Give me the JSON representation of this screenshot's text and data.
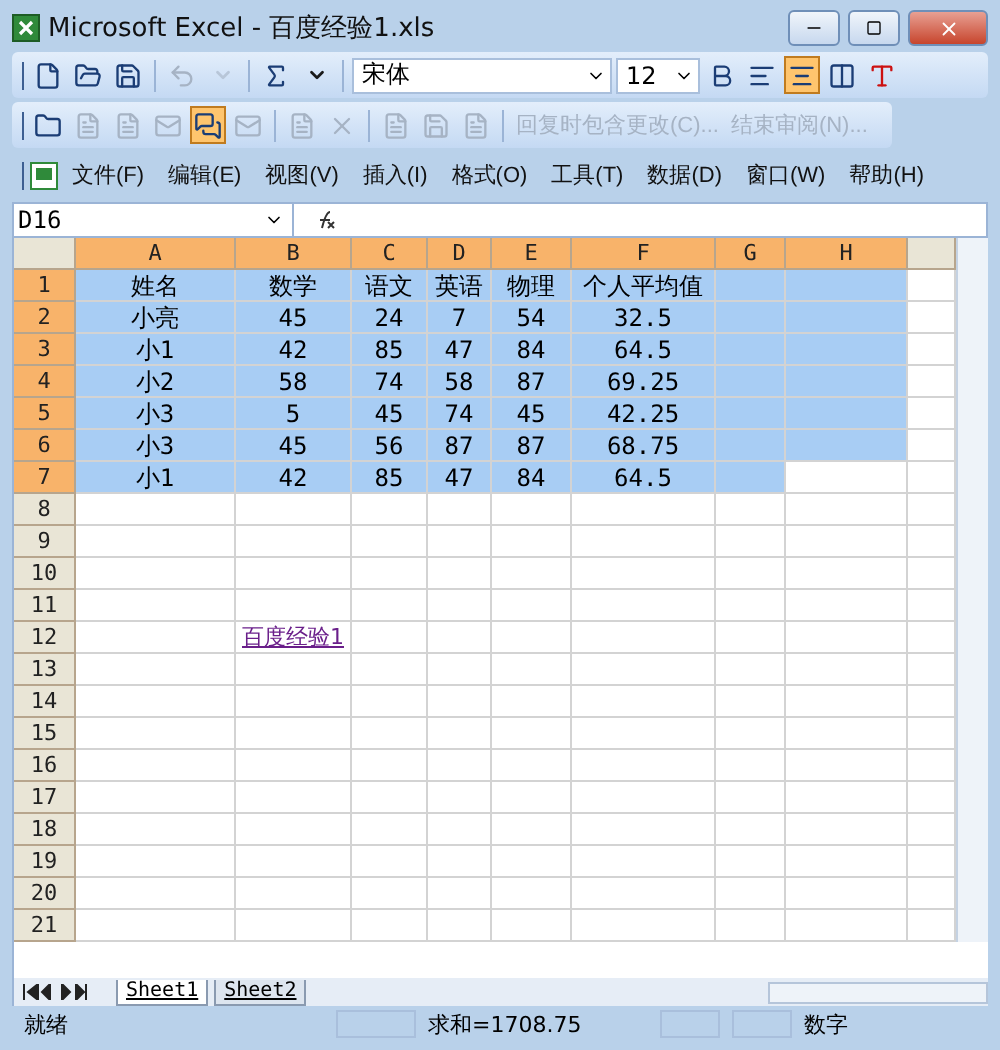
{
  "window": {
    "title": "Microsoft Excel - 百度经验1.xls"
  },
  "toolbar": {
    "items": [
      {
        "kind": "button",
        "disabled": false
      },
      {
        "kind": "button",
        "disabled": false
      },
      {
        "kind": "button",
        "disabled": false
      },
      {
        "kind": "sep"
      },
      {
        "kind": "button",
        "disabled": true
      },
      {
        "kind": "caret",
        "disabled": true
      },
      {
        "kind": "sep"
      },
      {
        "kind": "button",
        "disabled": false
      },
      {
        "kind": "caret",
        "disabled": false
      }
    ],
    "font": "宋体",
    "size": "12",
    "format": [
      {
        "selected": false
      },
      {
        "selected": false
      },
      {
        "selected": true
      },
      {
        "selected": false
      },
      {
        "selected": false
      }
    ]
  },
  "review_toolbar": {
    "items": [
      {
        "kind": "button",
        "disabled": false,
        "selected": false
      },
      {
        "kind": "button",
        "disabled": true,
        "selected": false
      },
      {
        "kind": "button",
        "disabled": true,
        "selected": false
      },
      {
        "kind": "button",
        "disabled": true,
        "selected": false
      },
      {
        "kind": "button",
        "disabled": false,
        "selected": true
      },
      {
        "kind": "button",
        "disabled": true,
        "selected": false
      },
      {
        "kind": "sep"
      },
      {
        "kind": "button",
        "disabled": true,
        "selected": false
      },
      {
        "kind": "button",
        "disabled": true,
        "selected": false
      },
      {
        "kind": "sep"
      },
      {
        "kind": "button",
        "disabled": true,
        "selected": false
      },
      {
        "kind": "button",
        "disabled": true,
        "selected": false
      },
      {
        "kind": "button",
        "disabled": true,
        "selected": false
      },
      {
        "kind": "sep"
      },
      {
        "kind": "text",
        "label": "回复时包含更改(C)...",
        "disabled": true
      },
      {
        "kind": "text",
        "label": "结束审阅(N)...",
        "disabled": true
      }
    ]
  },
  "menu": [
    "文件(F)",
    "编辑(E)",
    "视图(V)",
    "插入(I)",
    "格式(O)",
    "工具(T)",
    "数据(D)",
    "窗口(W)",
    "帮助(H)"
  ],
  "name_box": "D16",
  "columns": [
    {
      "label": "A",
      "selected": true
    },
    {
      "label": "B",
      "selected": true
    },
    {
      "label": "C",
      "selected": true
    },
    {
      "label": "D",
      "selected": true
    },
    {
      "label": "E",
      "selected": true
    },
    {
      "label": "F",
      "selected": true
    },
    {
      "label": "G",
      "selected": true
    },
    {
      "label": "H",
      "selected": true
    }
  ],
  "rows": [
    {
      "label": "1",
      "selected": true,
      "cells": [
        {
          "text": "姓名",
          "selected": true
        },
        {
          "text": "数学",
          "selected": true
        },
        {
          "text": "语文",
          "selected": true
        },
        {
          "text": "英语",
          "selected": true
        },
        {
          "text": "物理",
          "selected": true
        },
        {
          "text": "个人平均值",
          "selected": true
        },
        {
          "selected": true
        },
        {
          "selected": true
        }
      ]
    },
    {
      "label": "2",
      "selected": true,
      "cells": [
        {
          "text": "小亮",
          "selected": true
        },
        {
          "text": "45",
          "selected": true
        },
        {
          "text": "24",
          "selected": true
        },
        {
          "text": "7",
          "selected": true
        },
        {
          "text": "54",
          "selected": true
        },
        {
          "text": "32.5",
          "selected": true
        },
        {
          "selected": true
        },
        {
          "selected": true
        }
      ]
    },
    {
      "label": "3",
      "selected": true,
      "cells": [
        {
          "text": "小1",
          "selected": true
        },
        {
          "text": "42",
          "selected": true
        },
        {
          "text": "85",
          "selected": true
        },
        {
          "text": "47",
          "selected": true
        },
        {
          "text": "84",
          "selected": true
        },
        {
          "text": "64.5",
          "selected": true
        },
        {
          "selected": true
        },
        {
          "selected": true
        }
      ]
    },
    {
      "label": "4",
      "selected": true,
      "cells": [
        {
          "text": "小2",
          "selected": true
        },
        {
          "text": "58",
          "selected": true
        },
        {
          "text": "74",
          "selected": true
        },
        {
          "text": "58",
          "selected": true
        },
        {
          "text": "87",
          "selected": true
        },
        {
          "text": "69.25",
          "selected": true
        },
        {
          "selected": true
        },
        {
          "selected": true
        }
      ]
    },
    {
      "label": "5",
      "selected": true,
      "cells": [
        {
          "text": "小3",
          "selected": true
        },
        {
          "text": "5",
          "selected": true
        },
        {
          "text": "45",
          "selected": true
        },
        {
          "text": "74",
          "selected": true
        },
        {
          "text": "45",
          "selected": true
        },
        {
          "text": "42.25",
          "selected": true
        },
        {
          "selected": true
        },
        {
          "selected": true
        }
      ]
    },
    {
      "label": "6",
      "selected": true,
      "cells": [
        {
          "text": "小3",
          "selected": true
        },
        {
          "text": "45",
          "selected": true
        },
        {
          "text": "56",
          "selected": true
        },
        {
          "text": "87",
          "selected": true
        },
        {
          "text": "87",
          "selected": true
        },
        {
          "text": "68.75",
          "selected": true
        },
        {
          "selected": true
        },
        {
          "selected": true
        }
      ]
    },
    {
      "label": "7",
      "selected": true,
      "cells": [
        {
          "text": "小1",
          "selected": true
        },
        {
          "text": "42",
          "selected": true
        },
        {
          "text": "85",
          "selected": true
        },
        {
          "text": "47",
          "selected": true
        },
        {
          "text": "84",
          "selected": true
        },
        {
          "text": "64.5",
          "selected": true
        },
        {
          "selected": true
        },
        {
          "selected": false
        }
      ]
    },
    {
      "label": "8",
      "selected": false
    },
    {
      "label": "9",
      "selected": false
    },
    {
      "label": "10",
      "selected": false
    },
    {
      "label": "11",
      "selected": false
    },
    {
      "label": "12",
      "selected": false,
      "cells": [
        {
          "selected": false
        },
        {
          "text": "百度经验1",
          "kind": "link",
          "selected": false
        }
      ]
    },
    {
      "label": "13",
      "selected": false
    },
    {
      "label": "14",
      "selected": false
    },
    {
      "label": "15",
      "selected": false
    },
    {
      "label": "16",
      "selected": false
    },
    {
      "label": "17",
      "selected": false
    },
    {
      "label": "18",
      "selected": false
    },
    {
      "label": "19",
      "selected": false
    },
    {
      "label": "20",
      "selected": false
    },
    {
      "label": "21",
      "selected": false
    }
  ],
  "sheets": [
    {
      "label": "Sheet1",
      "selected": true
    },
    {
      "label": "Sheet2",
      "selected": false
    }
  ],
  "status_bar": {
    "state": "就绪",
    "sum": "求和=1708.75",
    "mode": "数字"
  }
}
